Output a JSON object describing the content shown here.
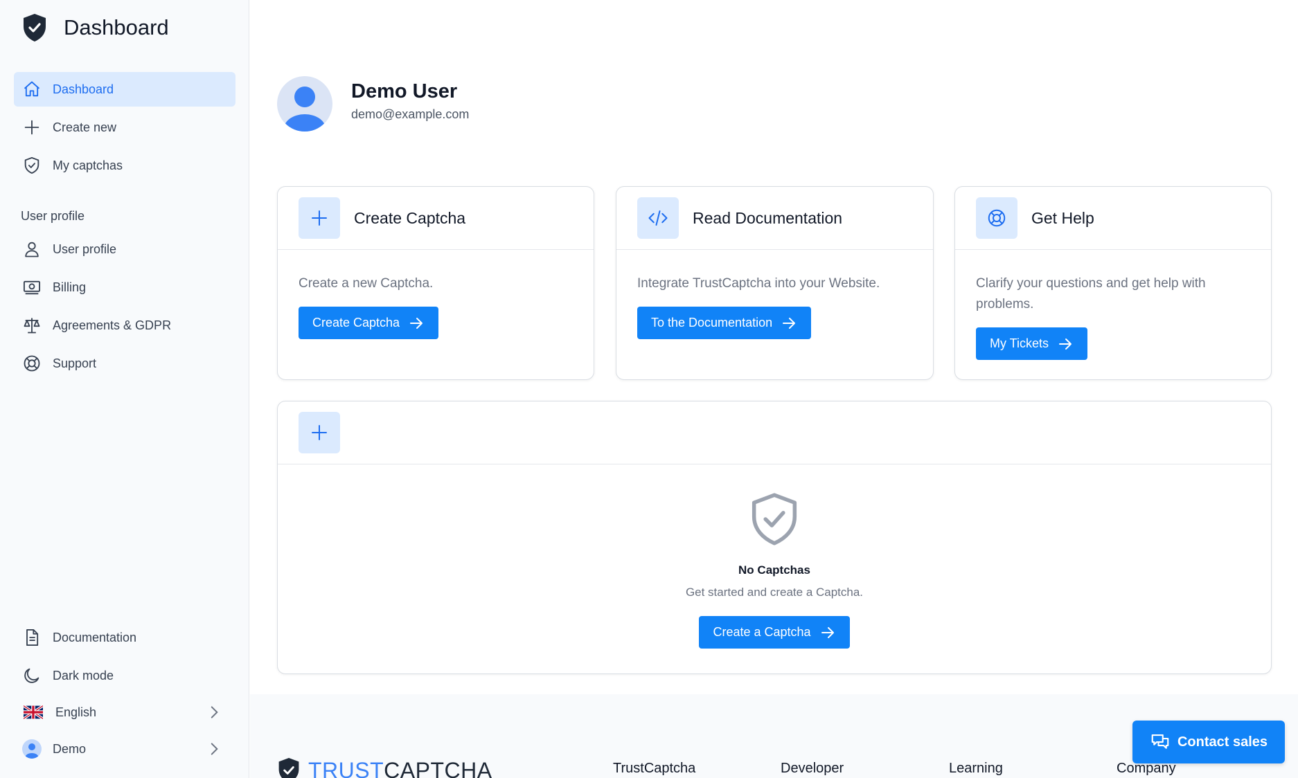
{
  "sidebar": {
    "title": "Dashboard",
    "nav": [
      {
        "label": "Dashboard",
        "icon": "home-icon"
      },
      {
        "label": "Create new",
        "icon": "plus-icon"
      },
      {
        "label": "My captchas",
        "icon": "shield-check-icon"
      }
    ],
    "section_label": "User profile",
    "profile_nav": [
      {
        "label": "User profile",
        "icon": "user-icon"
      },
      {
        "label": "Billing",
        "icon": "banknote-icon"
      },
      {
        "label": "Agreements & GDPR",
        "icon": "scale-icon"
      },
      {
        "label": "Support",
        "icon": "lifebuoy-icon"
      }
    ],
    "bottom_nav": [
      {
        "label": "Documentation",
        "icon": "document-icon"
      },
      {
        "label": "Dark mode",
        "icon": "moon-icon"
      },
      {
        "label": "English",
        "icon": "uk-flag-icon"
      },
      {
        "label": "Demo",
        "icon": "avatar-icon"
      }
    ]
  },
  "profile": {
    "name": "Demo User",
    "email": "demo@example.com"
  },
  "cards": [
    {
      "title": "Create Captcha",
      "description": "Create a new Captcha.",
      "button": "Create Captcha",
      "icon": "plus-icon"
    },
    {
      "title": "Read Documentation",
      "description": "Integrate TrustCaptcha into your Website.",
      "button": "To the Documentation",
      "icon": "code-icon"
    },
    {
      "title": "Get Help",
      "description": "Clarify your questions and get help with problems.",
      "button": "My Tickets",
      "icon": "lifebuoy-icon"
    }
  ],
  "captchas_panel": {
    "empty_title": "No Captchas",
    "empty_subtitle": "Get started and create a Captcha.",
    "button": "Create a Captcha"
  },
  "footer": {
    "brand_part1": "TRUST",
    "brand_part2": "CAPTCHA",
    "columns": [
      "TrustCaptcha",
      "Developer",
      "Learning",
      "Company"
    ]
  },
  "contact_button": "Contact sales",
  "colors": {
    "primary": "#1183f7",
    "active_bg": "#dbeafe",
    "sidebar_bg": "#f8fafc",
    "brand_dark": "#1f2937"
  }
}
